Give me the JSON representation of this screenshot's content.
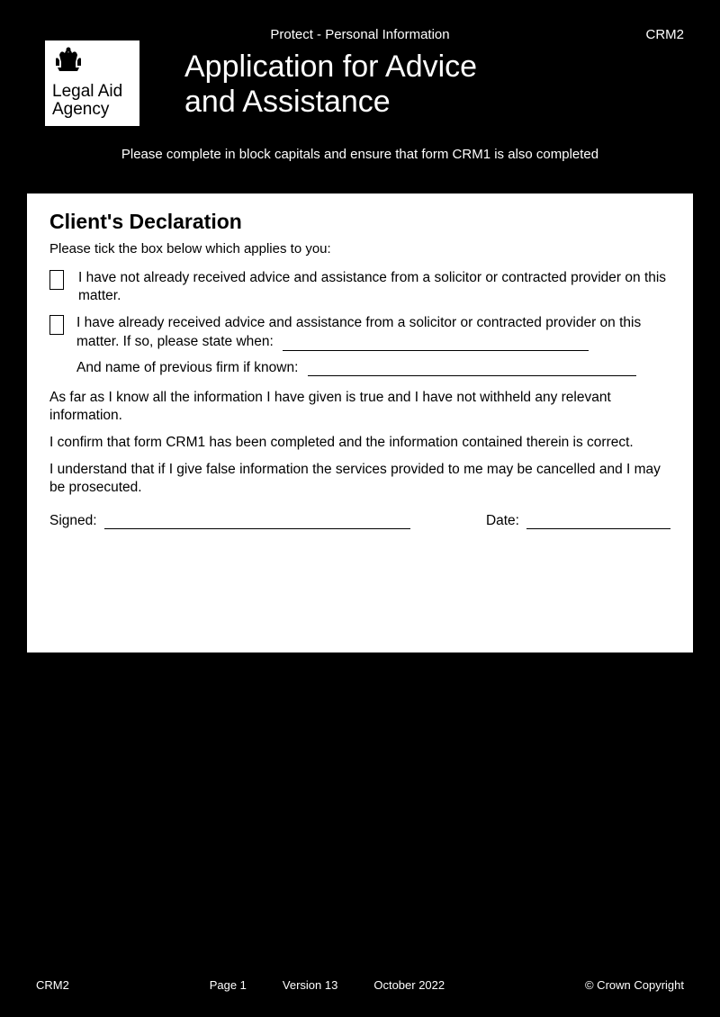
{
  "header": {
    "protect": "Protect - Personal Information",
    "form_code": "CRM2",
    "logo_line1": "Legal Aid",
    "logo_line2": "Agency",
    "title_line1": "Application for Advice",
    "title_line2": "and Assistance",
    "instruction": "Please complete in block capitals and ensure that form CRM1 is also completed"
  },
  "declaration": {
    "heading": "Client's Declaration",
    "intro": "Please tick the box below which applies to you:",
    "opt1": "I have not already received advice and assistance from a solicitor or contracted provider on this matter.",
    "opt2_a": "I have already received advice and assistance from a solicitor or contracted provider on this matter.  If so, please state when:",
    "opt2_firm": "And name of previous firm if known:",
    "para1": "As far as I know all the information I have given is true and I have not withheld any relevant information.",
    "para2": "I confirm that form CRM1 has been completed and the information contained therein is correct.",
    "para3": "I understand that if I give false information the services provided to me may be cancelled and I may be prosecuted.",
    "signed_label": "Signed:",
    "date_label": "Date:"
  },
  "footer": {
    "left": "CRM2",
    "page": "Page 1",
    "version": "Version 13",
    "date": "October 2022",
    "right": "© Crown Copyright"
  }
}
